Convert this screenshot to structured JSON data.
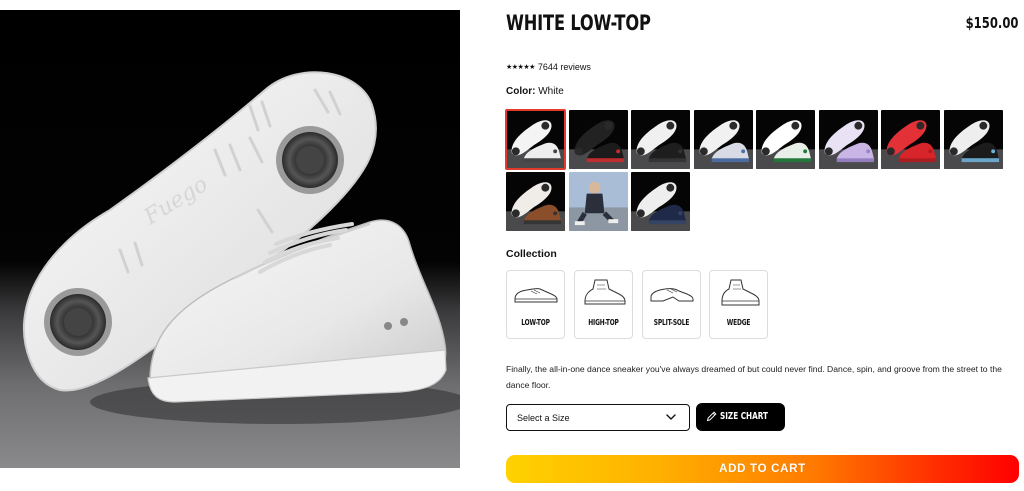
{
  "product": {
    "title": "WHITE LOW-TOP",
    "price": "$150.00",
    "rating_stars": "★★★★★",
    "reviews": "7644 reviews",
    "color_label": "Color:",
    "color_value": "White",
    "description": "Finally, the all-in-one dance sneaker you've always dreamed of but could never find. Dance, spin, and groove from the street to the dance floor."
  },
  "swatches": [
    {
      "name": "white",
      "selected": true,
      "shoe": "#eeeeee",
      "sole": "#f4f4f4",
      "accent": "#444444"
    },
    {
      "name": "black-red",
      "selected": false,
      "shoe": "#1b1b1b",
      "sole": "#222222",
      "accent": "#cc2b2b"
    },
    {
      "name": "black-white",
      "selected": false,
      "shoe": "#1e1e1e",
      "sole": "#f0f0f0",
      "accent": "#333333"
    },
    {
      "name": "white-blue",
      "selected": false,
      "shoe": "#d8dbe6",
      "sole": "#f1f1f1",
      "accent": "#4d6fa8"
    },
    {
      "name": "white-green",
      "selected": false,
      "shoe": "#e8efe8",
      "sole": "#ffffff",
      "accent": "#1f7a3b"
    },
    {
      "name": "lavender",
      "selected": false,
      "shoe": "#c9b6e6",
      "sole": "#e9e2f5",
      "accent": "#9b84c9"
    },
    {
      "name": "red",
      "selected": false,
      "shoe": "#d8242b",
      "sole": "#e33138",
      "accent": "#b51a1f"
    },
    {
      "name": "black-light-blue",
      "selected": false,
      "shoe": "#1c1c1c",
      "sole": "#eeeeee",
      "accent": "#6fb0d8"
    },
    {
      "name": "brown",
      "selected": false,
      "shoe": "#8a4e2a",
      "sole": "#f0ece7",
      "accent": "#333333"
    },
    {
      "name": "lifestyle-photo",
      "selected": false,
      "shoe": "#2a2f3b",
      "sole": "#9db4cf",
      "accent": "#d8c3a5"
    },
    {
      "name": "navy",
      "selected": false,
      "shoe": "#1f2a48",
      "sole": "#eeeeee",
      "accent": "#334466"
    }
  ],
  "collection": {
    "label": "Collection",
    "items": [
      {
        "label": "LOW-TOP"
      },
      {
        "label": "HIGH-TOP"
      },
      {
        "label": "SPLIT-SOLE"
      },
      {
        "label": "WEDGE"
      }
    ]
  },
  "size": {
    "placeholder": "Select a Size",
    "chart_label": "SIZE CHART"
  },
  "cart": {
    "label": "ADD TO CART"
  },
  "colors": {
    "selected_outline": "#e23b2e",
    "cart_gradient_start": "#ffd200",
    "cart_gradient_end": "#ff0000"
  },
  "icons": {
    "size_select": "chevron-down-icon",
    "size_chart": "ruler-pencil-icon"
  }
}
